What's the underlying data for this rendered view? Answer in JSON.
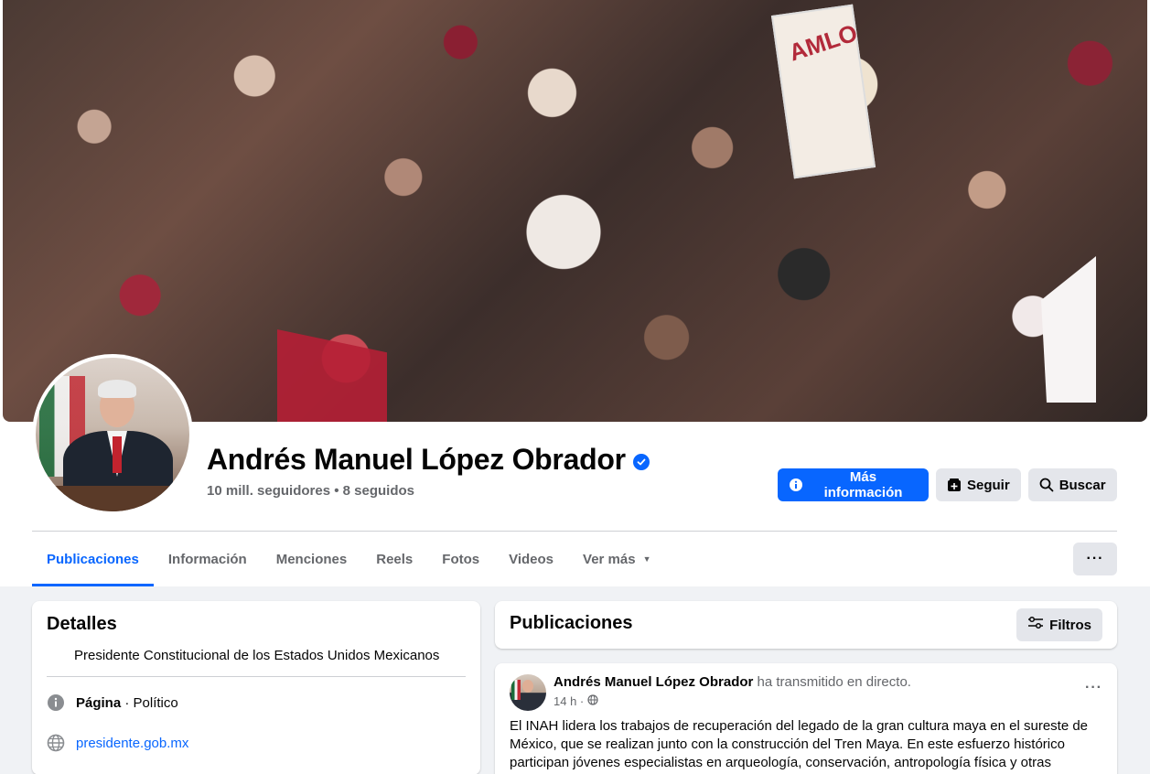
{
  "profile": {
    "name": "Andrés Manuel López Obrador",
    "followers": "10 mill. seguidores • 8 seguidos",
    "cover_sign_text": "AMLO"
  },
  "actions": {
    "info": "Más información",
    "follow": "Seguir",
    "search": "Buscar"
  },
  "tabs": [
    {
      "label": "Publicaciones"
    },
    {
      "label": "Información"
    },
    {
      "label": "Menciones"
    },
    {
      "label": "Reels"
    },
    {
      "label": "Fotos"
    },
    {
      "label": "Videos"
    },
    {
      "label": "Ver más"
    }
  ],
  "details": {
    "title": "Detalles",
    "description": "Presidente Constitucional de los Estados Unidos Mexicanos",
    "page_label": "Página",
    "page_category": " · Político",
    "website": "presidente.gob.mx"
  },
  "publications": {
    "title": "Publicaciones",
    "filters_label": "Filtros"
  },
  "post": {
    "author": "Andrés Manuel López Obrador",
    "action": " ha transmitido en directo.",
    "time": "14 h ·",
    "text": "El INAH lidera los trabajos de recuperación del legado de la gran cultura maya en el sureste de México, que se realizan junto con la construcción del Tren Maya. En este esfuerzo histórico participan jóvenes especialistas en arqueología, conservación, antropología física y otras"
  },
  "colors": {
    "accent": "#0866ff",
    "background": "#f0f2f5",
    "secondary_text": "#65676b"
  },
  "icons": {
    "info_icon": "info-icon",
    "follow_icon": "follow-icon",
    "search_icon": "search-icon",
    "verified_icon": "verified-badge-icon",
    "globe_icon": "globe-icon",
    "filter_icon": "filter-icon"
  }
}
